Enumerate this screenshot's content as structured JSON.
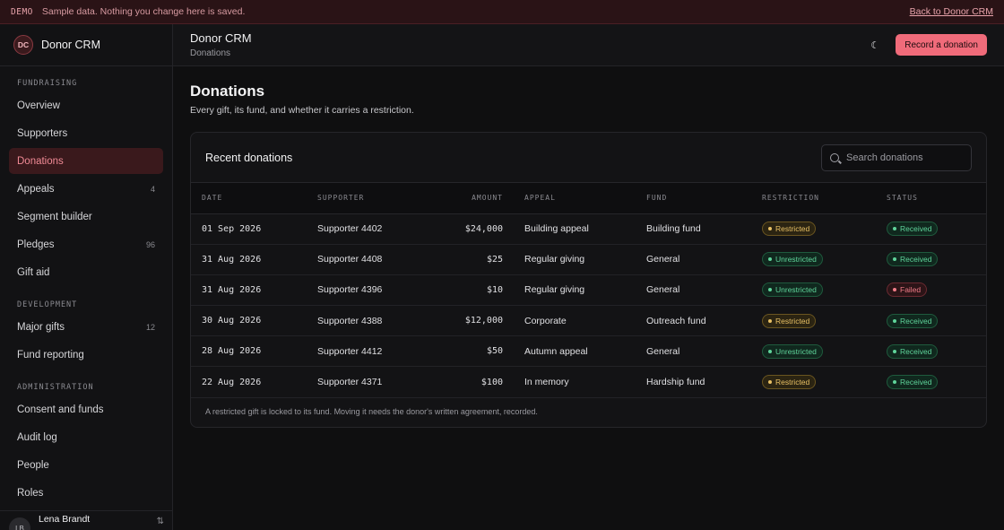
{
  "demo_bar": {
    "tag": "DEMO",
    "message": "Sample data. Nothing you change here is saved.",
    "link": "Back to Donor CRM"
  },
  "sidebar": {
    "brand_initials": "DC",
    "brand_name": "Donor CRM",
    "sections": [
      {
        "heading": "FUNDRAISING",
        "items": [
          {
            "label": "Overview",
            "count": ""
          },
          {
            "label": "Supporters",
            "count": ""
          },
          {
            "label": "Donations",
            "count": "",
            "active": true
          },
          {
            "label": "Appeals",
            "count": "4"
          },
          {
            "label": "Segment builder",
            "count": ""
          },
          {
            "label": "Pledges",
            "count": "96"
          },
          {
            "label": "Gift aid",
            "count": ""
          }
        ]
      },
      {
        "heading": "DEVELOPMENT",
        "items": [
          {
            "label": "Major gifts",
            "count": "12"
          },
          {
            "label": "Fund reporting",
            "count": ""
          }
        ]
      },
      {
        "heading": "ADMINISTRATION",
        "items": [
          {
            "label": "Consent and funds",
            "count": ""
          },
          {
            "label": "Audit log",
            "count": ""
          },
          {
            "label": "People",
            "count": ""
          },
          {
            "label": "Roles",
            "count": ""
          }
        ]
      }
    ],
    "user": {
      "initials": "LB",
      "name": "Lena Brandt",
      "icon": "switch-icon"
    }
  },
  "topbar": {
    "title": "Donor CRM",
    "subtitle": "Donations",
    "theme_icon": "moon-icon",
    "primary_button": "Record a donation"
  },
  "page": {
    "title": "Donations",
    "subtitle": "Every gift, its fund, and whether it carries a restriction."
  },
  "card": {
    "title": "Recent donations",
    "search_placeholder": "Search donations",
    "columns": [
      "DATE",
      "SUPPORTER",
      "AMOUNT",
      "APPEAL",
      "FUND",
      "RESTRICTION",
      "STATUS"
    ],
    "rows": [
      {
        "date": "01 Sep 2026",
        "supporter": "Supporter 4402",
        "amount": "$24,000",
        "appeal": "Building appeal",
        "fund": "Building fund",
        "restriction": "Restricted",
        "status": "Received"
      },
      {
        "date": "31 Aug 2026",
        "supporter": "Supporter 4408",
        "amount": "$25",
        "appeal": "Regular giving",
        "fund": "General",
        "restriction": "Unrestricted",
        "status": "Received"
      },
      {
        "date": "31 Aug 2026",
        "supporter": "Supporter 4396",
        "amount": "$10",
        "appeal": "Regular giving",
        "fund": "General",
        "restriction": "Unrestricted",
        "status": "Failed"
      },
      {
        "date": "30 Aug 2026",
        "supporter": "Supporter 4388",
        "amount": "$12,000",
        "appeal": "Corporate",
        "fund": "Outreach fund",
        "restriction": "Restricted",
        "status": "Received"
      },
      {
        "date": "28 Aug 2026",
        "supporter": "Supporter 4412",
        "amount": "$50",
        "appeal": "Autumn appeal",
        "fund": "General",
        "restriction": "Unrestricted",
        "status": "Received"
      },
      {
        "date": "22 Aug 2026",
        "supporter": "Supporter 4371",
        "amount": "$100",
        "appeal": "In memory",
        "fund": "Hardship fund",
        "restriction": "Restricted",
        "status": "Received"
      }
    ],
    "footnote": "A restricted gift is locked to its fund. Moving it needs the donor's written agreement, recorded."
  },
  "colors": {
    "accent": "#f06b7a",
    "restricted": "#e8c064",
    "unrestricted": "#5fd49a",
    "received": "#5fd49a",
    "failed": "#f07c88"
  }
}
